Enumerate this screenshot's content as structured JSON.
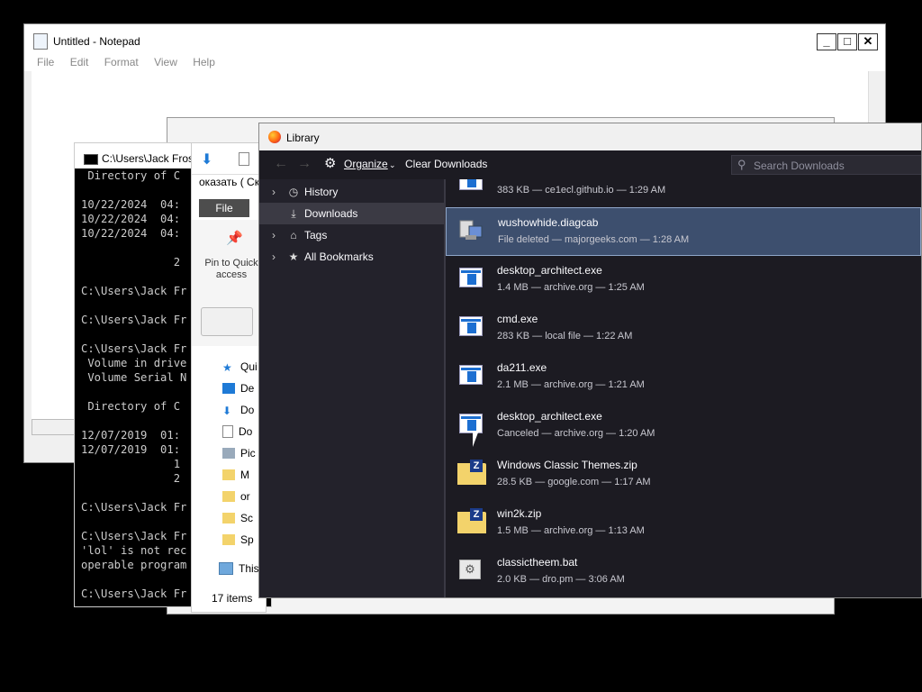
{
  "notepad": {
    "title": "Untitled - Notepad",
    "menu": [
      "File",
      "Edit",
      "Format",
      "View",
      "Help"
    ],
    "caption": {
      "min": "_",
      "max": "□",
      "close": "✕"
    }
  },
  "console": {
    "title": "C:\\Users\\Jack Frost",
    "lines": [
      " Directory of C",
      "",
      "10/22/2024  04:",
      "10/22/2024  04:",
      "10/22/2024  04:",
      "",
      "              2",
      "",
      "C:\\Users\\Jack Fr",
      "",
      "C:\\Users\\Jack Fr",
      "",
      "C:\\Users\\Jack Fr",
      " Volume in drive",
      " Volume Serial N",
      "",
      " Directory of C",
      "",
      "12/07/2019  01:",
      "12/07/2019  01:",
      "              1",
      "              2",
      "",
      "C:\\Users\\Jack Fr",
      "",
      "C:\\Users\\Jack Fr",
      "'lol' is not rec",
      "operable program",
      "",
      "C:\\Users\\Jack Fr"
    ]
  },
  "explorer": {
    "ribbon_tab_text": "оказать ( Ск",
    "file_button": "File",
    "pin_label": "Pin to Quick access",
    "nav": [
      "Qui",
      "De",
      "Do",
      "Do",
      "Pic",
      "M",
      "or",
      "Sc",
      "Sp",
      "This"
    ],
    "status": "17 items"
  },
  "library": {
    "title": "Library",
    "organize": "Organize",
    "clear_downloads": "Clear Downloads",
    "search_placeholder": "Search Downloads",
    "sidebar": [
      {
        "label": "History",
        "icon": "clock-icon",
        "has_chevron": true
      },
      {
        "label": "Downloads",
        "icon": "download-icon",
        "has_chevron": false,
        "selected": true
      },
      {
        "label": "Tags",
        "icon": "tag-icon",
        "has_chevron": true
      },
      {
        "label": "All Bookmarks",
        "icon": "star-icon",
        "has_chevron": true
      }
    ],
    "downloads": [
      {
        "name": "",
        "meta": "383 KB — ce1ecl.github.io — 1:29 AM",
        "icon": "exe"
      },
      {
        "name": "wushowhide.diagcab",
        "meta": "File deleted — majorgeeks.com — 1:28 AM",
        "icon": "cab",
        "selected": true
      },
      {
        "name": "desktop_architect.exe",
        "meta": "1.4 MB — archive.org — 1:25 AM",
        "icon": "exe"
      },
      {
        "name": "cmd.exe",
        "meta": "283 KB — local file — 1:22 AM",
        "icon": "exe"
      },
      {
        "name": "da211.exe",
        "meta": "2.1 MB — archive.org — 1:21 AM",
        "icon": "exe"
      },
      {
        "name": "desktop_architect.exe",
        "meta": "Canceled — archive.org — 1:20 AM",
        "icon": "exe"
      },
      {
        "name": "Windows Classic Themes.zip",
        "meta": "28.5 KB — google.com — 1:17 AM",
        "icon": "zip"
      },
      {
        "name": "win2k.zip",
        "meta": "1.5 MB — archive.org — 1:13 AM",
        "icon": "zip"
      },
      {
        "name": "classictheem.bat",
        "meta": "2.0 KB — dro.pm — 3:06 AM",
        "icon": "bat"
      }
    ]
  }
}
